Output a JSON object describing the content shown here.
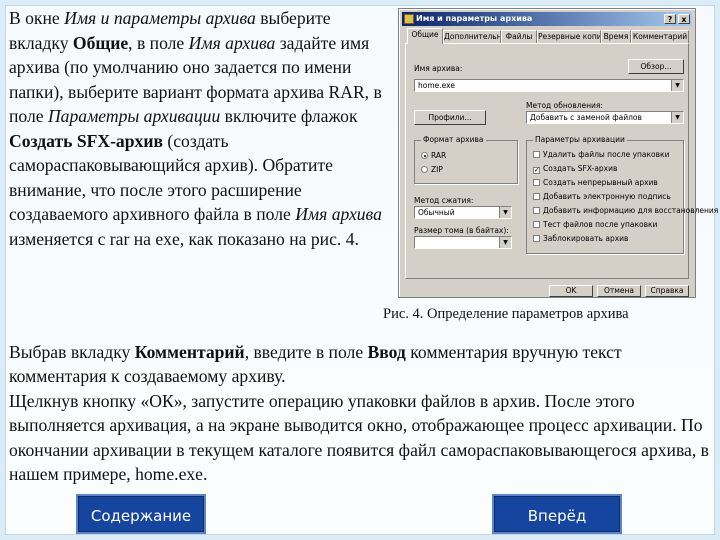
{
  "paragraph1": {
    "t1": "В окне ",
    "i1": "Имя и параметры архива",
    "t2": " выберите вкладку ",
    "b1": "Общие",
    "t3": ", в поле ",
    "i2": "Имя архива",
    "t4": " задайте имя архива (по умолчанию оно задается по имени папки), выберите вариант формата архива RAR, в поле ",
    "i3": "Параметры архивации",
    "t5": " включите флажок ",
    "b2": "Создать SFX-архив",
    "t6": " (создать самораспаковывающийся архив). Обратите внимание, что после этого расширение создаваемого архивного файла в поле ",
    "i4": "Имя архива",
    "t7": " изменяется с rar на exe, как показано на рис. 4."
  },
  "caption": "Рис. 4. Определение параметров архива",
  "paragraph2": {
    "t1": "Выбрав вкладку ",
    "b1": "Комментарий",
    "t2": ", введите в поле ",
    "b2": "Ввод",
    "t3": " комментария вручную текст комментария к создаваемому архиву."
  },
  "paragraph3": "Щелкнув кнопку «ОК», запустите операцию упаковки файлов в архив. После этого выполняется архивация, а на экране выводится окно, отображающее процесс архивации. По окончании архивации в текущем каталоге появится файл самораспаковывающегося архива, в нашем примере, home.exe.",
  "dialog": {
    "title": "Имя и параметры архива",
    "help_btn": "?",
    "close_btn": "x",
    "tabs": [
      "Общие",
      "Дополнительно",
      "Файлы",
      "Резервные копии",
      "Время",
      "Комментарий"
    ],
    "archive_name_label": "Имя архива:",
    "browse_label": "Обзор...",
    "archive_name_value": "home.exe",
    "update_method_label": "Метод обновления:",
    "profiles_label": "Профили...",
    "update_method_value": "Добавить с заменой файлов",
    "format_group": "Формат архива",
    "format_options": [
      "RAR",
      "ZIP"
    ],
    "compression_label": "Метод сжатия:",
    "compression_value": "Обычный",
    "split_label": "Размер тома (в байтах):",
    "params_group": "Параметры архивации",
    "params_options": [
      "Удалить файлы после упаковки",
      "Создать SFX-архив",
      "Создать непрерывный архив",
      "Добавить электронную подпись",
      "Добавить информацию для восстановления",
      "Тест файлов после упаковки",
      "Заблокировать архив"
    ],
    "params_checked": [
      false,
      true,
      false,
      false,
      false,
      false,
      false
    ],
    "footer_buttons": [
      "OK",
      "Отмена",
      "Справка"
    ]
  },
  "nav": {
    "contents_label": "Содержание",
    "next_label": "Вперёд"
  }
}
